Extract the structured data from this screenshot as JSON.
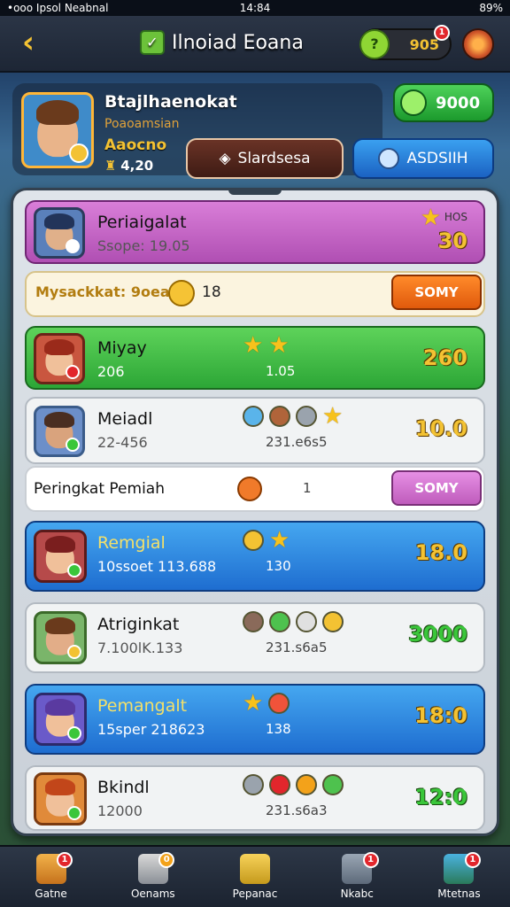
{
  "status": {
    "carrier": "•ooo Ipsol Neabnal",
    "time": "14:84",
    "battery": "89%"
  },
  "header": {
    "title": "Ilnoiad Eoana",
    "coins": "905",
    "coins_badge": "1"
  },
  "profile": {
    "name": "Btajlhaenokat",
    "subtitle": "Poaoamsian",
    "level": "Aaocno",
    "trophies": "4,20",
    "gems": "9000"
  },
  "buttons": {
    "primary": "Slardsesa",
    "secondary": "ASDSIIH"
  },
  "rows": [
    {
      "name": "Periaigalat",
      "score": "Ssope: 19.05",
      "badge_text": "HOS",
      "points": "30",
      "theme": "purple"
    },
    {
      "name": "Mysackkat: 9oeai",
      "count": "18",
      "action": "SOMY",
      "theme": "banner"
    },
    {
      "name": "Miyay",
      "score": "206",
      "mid": "1.05",
      "points": "260",
      "theme": "green"
    },
    {
      "name": "Meiadl",
      "score": "22-456",
      "mid": "231.e6s5",
      "points": "10.0",
      "theme": "white"
    },
    {
      "name": "Peringkat Pemiah",
      "mid": "1",
      "action": "SOMY",
      "theme": "banner2"
    },
    {
      "name": "Remgial",
      "score": "10ssoet 113.688",
      "mid": "130",
      "points": "18.0",
      "theme": "blue"
    },
    {
      "name": "Atriginkat",
      "score": "7.100lK.133",
      "mid": "231.s6a5",
      "points": "3000",
      "theme": "white"
    },
    {
      "name": "Pemangalt",
      "score": "15sper 218623",
      "mid": "138",
      "points": "18:0",
      "theme": "blue"
    },
    {
      "name": "Bkindl",
      "score": "12000",
      "mid": "231.s6a3",
      "points": "12:0",
      "theme": "white"
    }
  ],
  "nav": [
    {
      "label": "Gatne",
      "badge": "1"
    },
    {
      "label": "Oenams",
      "badge": "0"
    },
    {
      "label": "Pepanac",
      "badge": ""
    },
    {
      "label": "Nkabc",
      "badge": "1"
    },
    {
      "label": "Mtetnas",
      "badge": "1"
    }
  ],
  "colors": {
    "purple": "#c565cc",
    "green": "#4cc04c",
    "blue": "#2f8ee0",
    "white": "#eef0f2",
    "gold": "#f3c233"
  }
}
